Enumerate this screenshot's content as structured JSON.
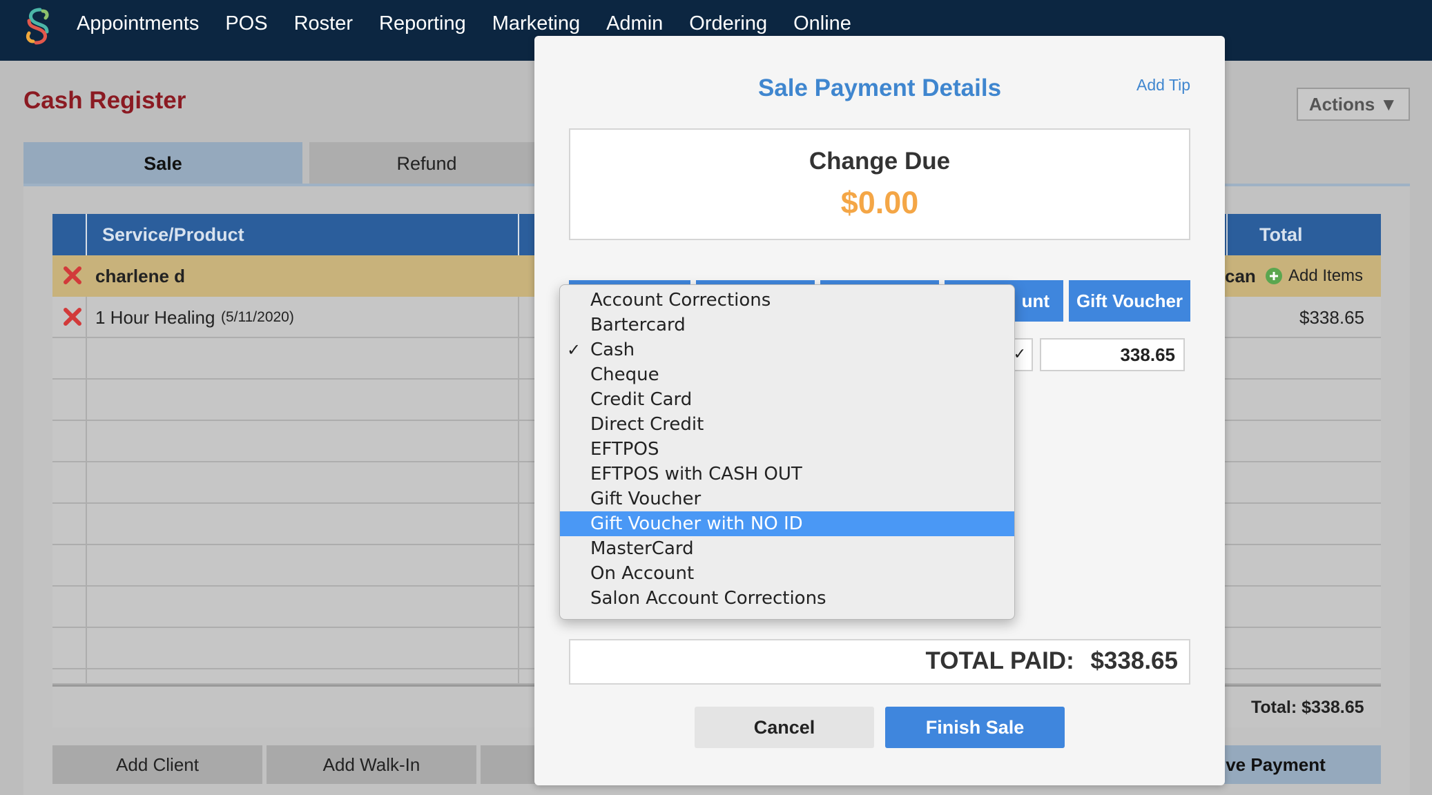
{
  "nav": {
    "items": [
      "Appointments",
      "POS",
      "Roster",
      "Reporting",
      "Marketing",
      "Admin",
      "Ordering",
      "Online"
    ]
  },
  "page": {
    "title": "Cash Register",
    "actions_label": "Actions ▼",
    "tabs": [
      "Sale",
      "Refund"
    ]
  },
  "table": {
    "headers": {
      "service": "Service/Product",
      "total": "Total"
    },
    "client_row": {
      "name": "charlene d",
      "partial_label": "can",
      "add_items_label": "Add Items"
    },
    "items": [
      {
        "name": "1 Hour Healing",
        "date": "(5/11/2020)",
        "total": "$338.65"
      }
    ],
    "total_label": "Total: $338.65"
  },
  "bottom_buttons": {
    "add_client": "Add Client",
    "add_walkin": "Add Walk-In",
    "give_payment": "ive Payment"
  },
  "modal": {
    "title": "Sale Payment Details",
    "add_tip": "Add Tip",
    "change_due_label": "Change Due",
    "change_due_amount": "$0.00",
    "payment_buttons": [
      "",
      "",
      "",
      "unt",
      "Gift Voucher"
    ],
    "amount_value": "338.65",
    "total_paid_label": "TOTAL PAID:",
    "total_paid_value": "$338.65",
    "cancel_label": "Cancel",
    "finish_label": "Finish Sale"
  },
  "dropdown": {
    "selected": "Cash",
    "highlighted": "Gift Voucher with NO ID",
    "options": [
      "Account Corrections",
      "Bartercard",
      "Cash",
      "Cheque",
      "Credit Card",
      "Direct Credit",
      "EFTPOS",
      "EFTPOS with CASH OUT",
      "Gift Voucher",
      "Gift Voucher with NO ID",
      "MasterCard",
      "On Account",
      "Salon Account Corrections"
    ]
  },
  "colors": {
    "nav_bg": "#0c2641",
    "title_red": "#8b1a22",
    "accent_blue": "#3f86dd",
    "change_orange": "#f4a646",
    "highlight_blue": "#4a98f5"
  }
}
